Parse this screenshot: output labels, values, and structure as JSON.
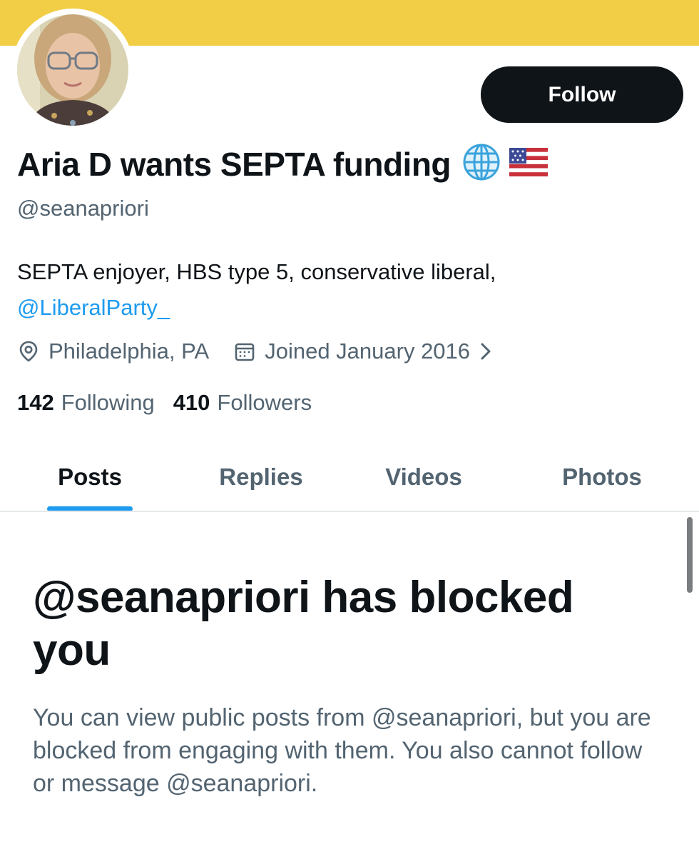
{
  "profile": {
    "display_name": "Aria D wants SEPTA funding",
    "name_icons": [
      "globe-icon",
      "us-flag-icon"
    ],
    "handle": "@seanapriori",
    "follow_label": "Follow",
    "bio_text": "SEPTA enjoyer, HBS type 5, conservative liberal,",
    "bio_link": "@LiberalParty_",
    "location": "Philadelphia, PA",
    "joined": "Joined January 2016",
    "following_count": "142",
    "following_label": "Following",
    "followers_count": "410",
    "followers_label": "Followers"
  },
  "tabs": [
    {
      "label": "Posts",
      "active": true
    },
    {
      "label": "Replies",
      "active": false
    },
    {
      "label": "Videos",
      "active": false
    },
    {
      "label": "Photos",
      "active": false
    }
  ],
  "blocked": {
    "title": "@seanapriori has blocked you",
    "description": "You can view public posts from @seanapriori, but you are blocked from engaging with them. You also cannot follow or message @seanapriori."
  },
  "colors": {
    "banner": "#f2ce46",
    "accent": "#1d9bf0",
    "text_primary": "#0f1419",
    "text_secondary": "#536471",
    "button_bg": "#0f1419"
  }
}
